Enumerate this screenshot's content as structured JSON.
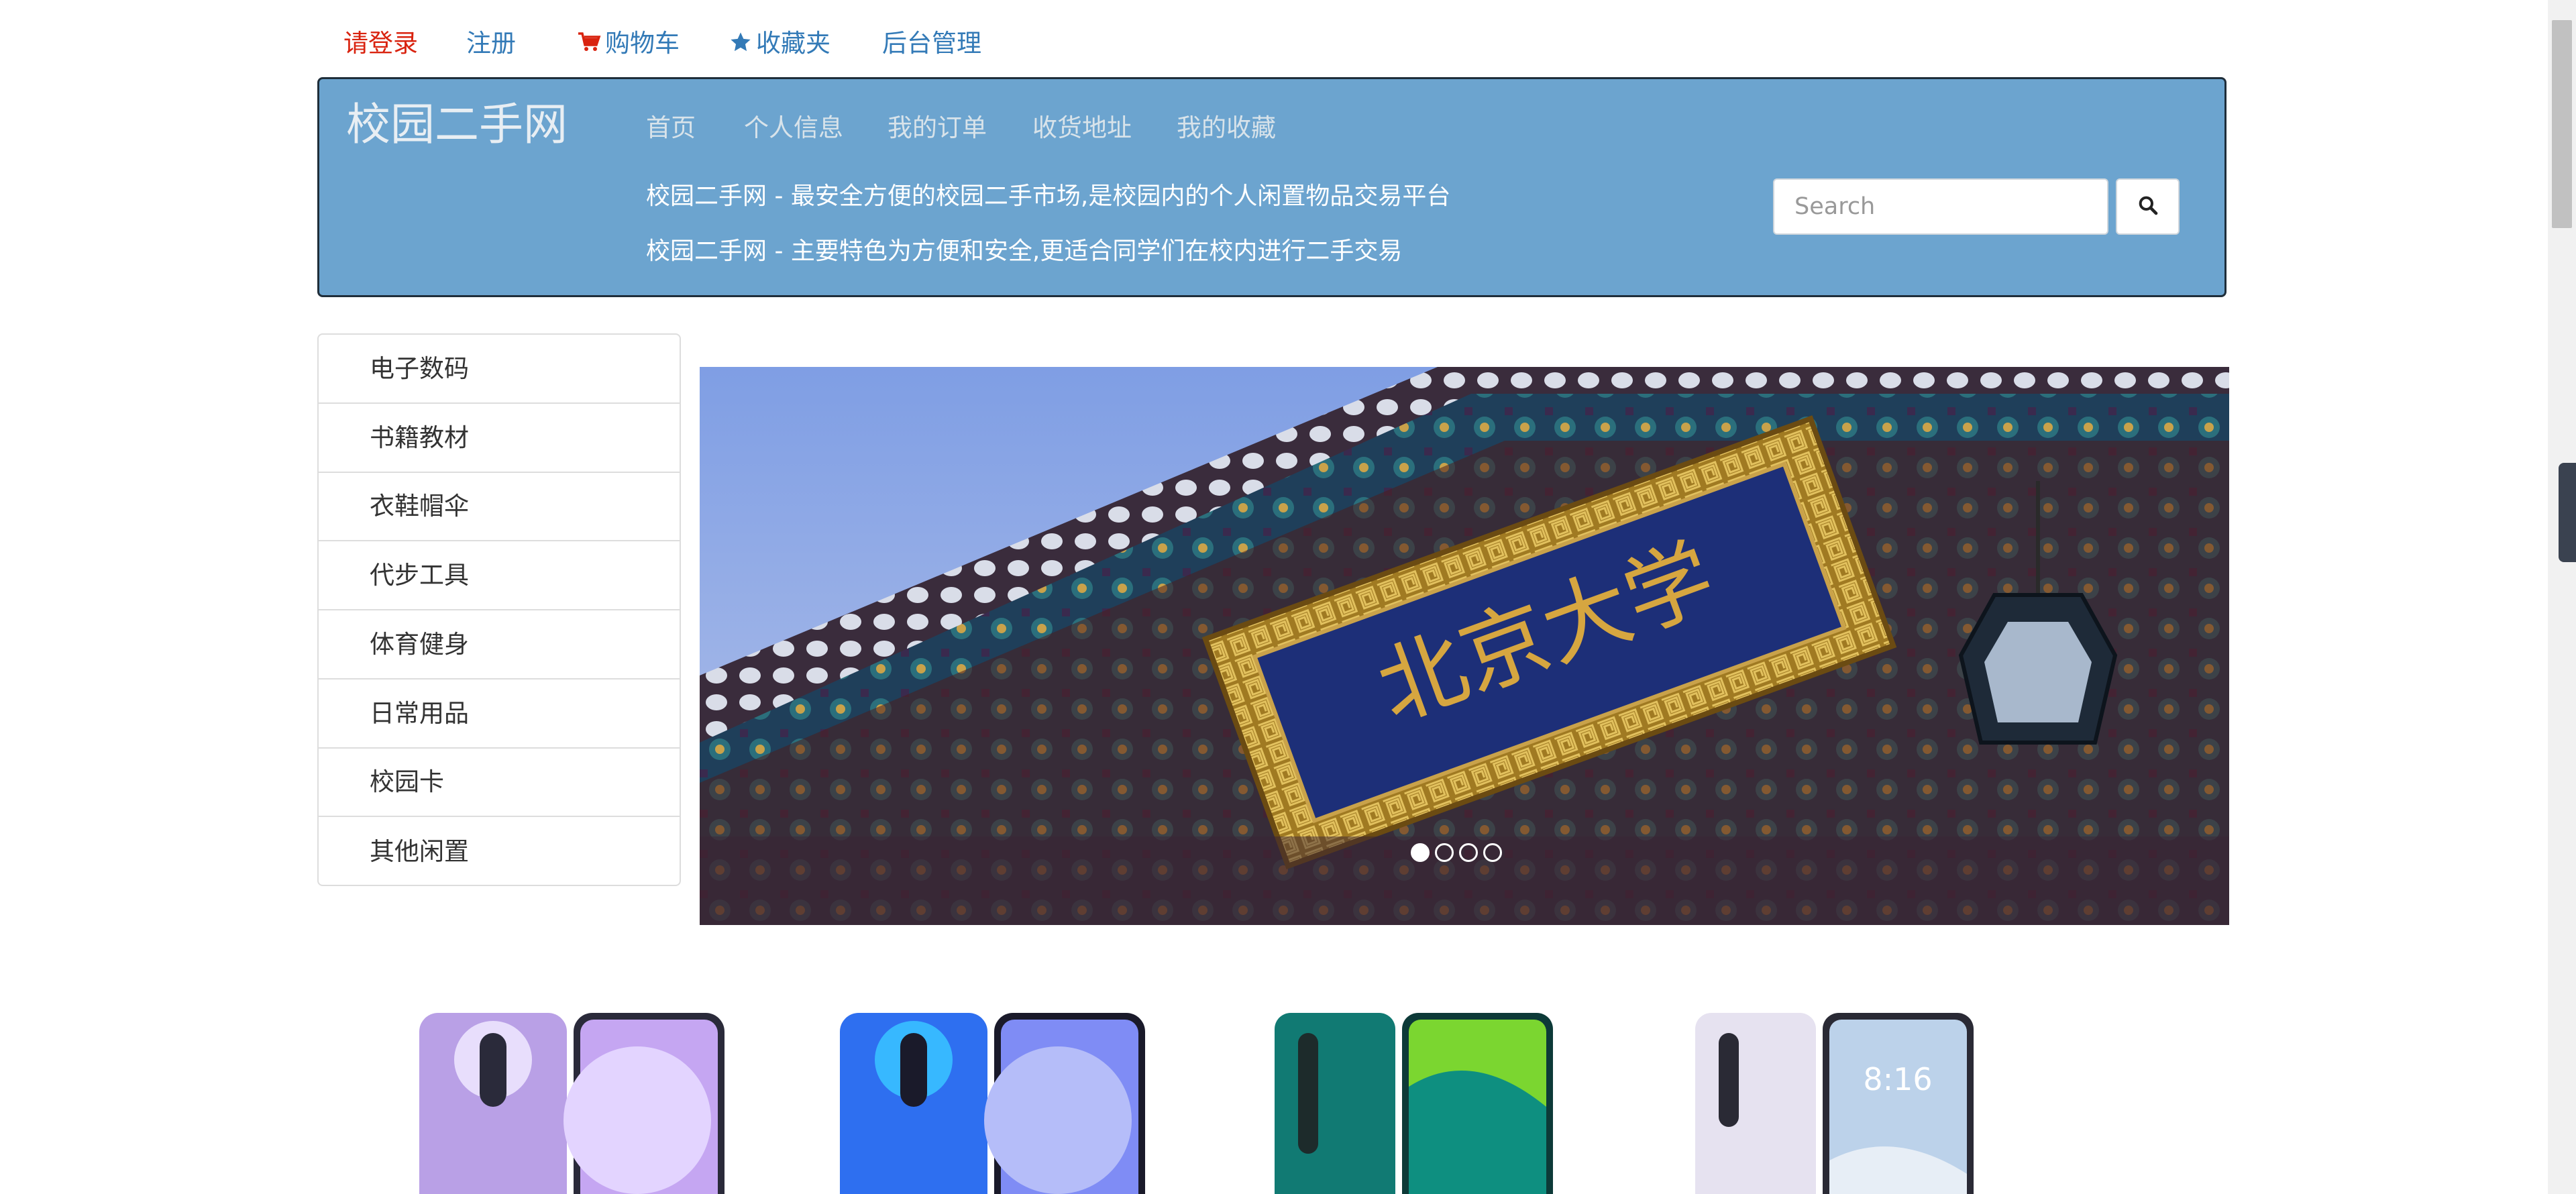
{
  "topbar": {
    "login": "请登录",
    "register": "注册",
    "cart": "购物车",
    "favorites": "收藏夹",
    "admin": "后台管理"
  },
  "header": {
    "brand": "校园二手网",
    "nav": [
      "首页",
      "个人信息",
      "我的订单",
      "收货地址",
      "我的收藏"
    ],
    "tagline1": "校园二手网 - 最安全方便的校园二手市场,是校园内的个人闲置物品交易平台",
    "tagline2": "校园二手网 - 主要特色为方便和安全,更适合同学们在校内进行二手交易",
    "search_placeholder": "Search"
  },
  "categories": [
    "电子数码",
    "书籍教材",
    "衣鞋帽伞",
    "代步工具",
    "体育健身",
    "日常用品",
    "校园卡",
    "其他闲置"
  ],
  "carousel": {
    "plaque_text": "北京大学",
    "slide_count": 4,
    "active_slide": 1
  },
  "products": {
    "phone4_time": "8:16"
  },
  "colors": {
    "header_bg": "#6ca4cf",
    "link": "#337ab7",
    "login_red": "#d9230f"
  }
}
